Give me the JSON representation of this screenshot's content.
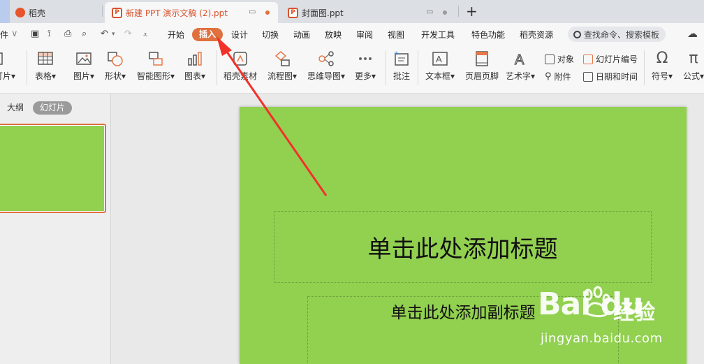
{
  "tabs": [
    {
      "label": "稻壳"
    },
    {
      "label": "新建 PPT 演示文稿 (2).ppt"
    },
    {
      "label": "封面图.ppt"
    }
  ],
  "menu": {
    "file_fragment": "件",
    "items": [
      "开始",
      "插入",
      "设计",
      "切换",
      "动画",
      "放映",
      "审阅",
      "视图",
      "开发工具",
      "特色功能",
      "稻壳资源"
    ],
    "search_placeholder": "查找命令、搜索模板"
  },
  "ribbon": {
    "slide_fragment": "灯片",
    "buttons": [
      "表格",
      "图片",
      "形状",
      "智能图形",
      "图表",
      "稻壳素材",
      "流程图",
      "思维导图",
      "更多",
      "批注",
      "文本框",
      "页眉页脚",
      "艺术字",
      "符号",
      "公式"
    ],
    "small": [
      "对象",
      "幻灯片编号",
      "附件",
      "日期和时间"
    ]
  },
  "left_panel": {
    "tab_outline": "大纲",
    "tab_slides": "幻灯片"
  },
  "slide": {
    "title_placeholder": "单击此处添加标题",
    "subtitle_placeholder": "单击此处添加副标题",
    "background_color": "#92d050"
  },
  "watermark": {
    "logo_text": "Bai du",
    "cn_text": "经验",
    "url": "jingyan.baidu.com"
  },
  "colors": {
    "accent": "#e0703e",
    "arrow": "#f2312a"
  }
}
